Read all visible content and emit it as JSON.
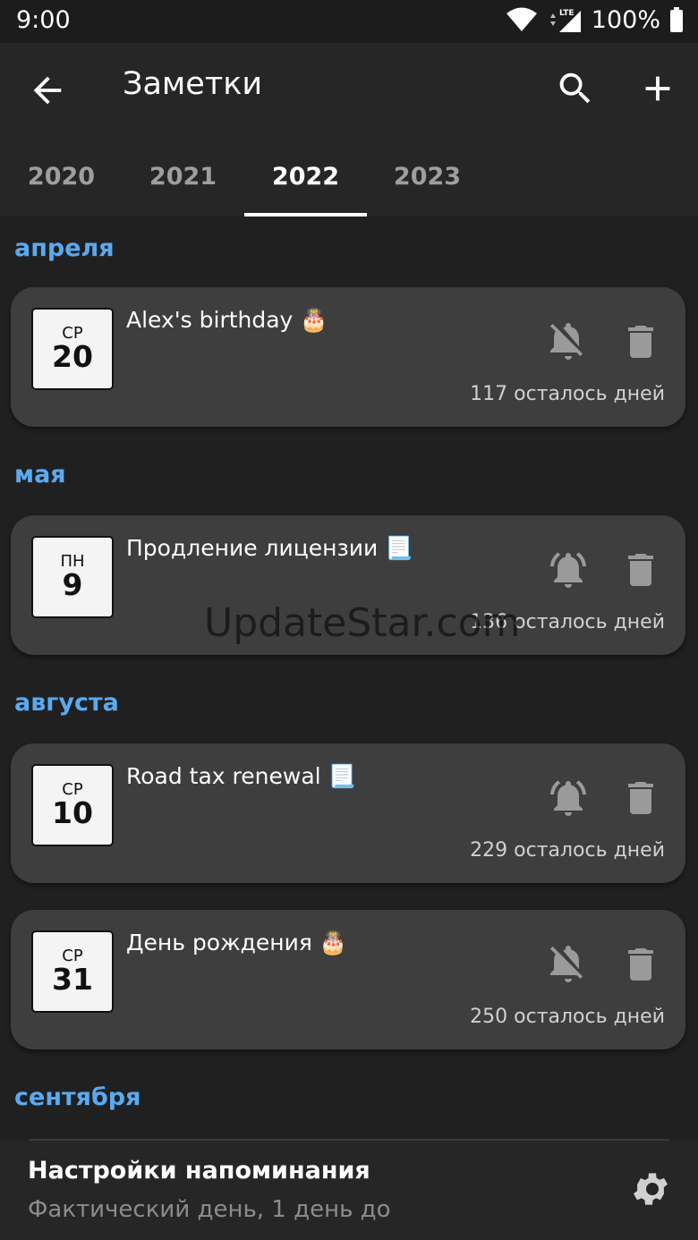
{
  "status": {
    "time": "9:00",
    "network": "LTE",
    "battery": "100%"
  },
  "appbar": {
    "title": "Заметки"
  },
  "tabs": [
    {
      "label": "2020"
    },
    {
      "label": "2021"
    },
    {
      "label": "2022",
      "active": true
    },
    {
      "label": "2023"
    }
  ],
  "months": [
    {
      "label": "апреля"
    },
    {
      "label": "мая"
    },
    {
      "label": "августа"
    },
    {
      "label": "сентября"
    }
  ],
  "notes": [
    {
      "dow": "СР",
      "day": "20",
      "title": "Alex's birthday 🎂",
      "remaining": "117 осталось дней",
      "bell": "bell-off-icon"
    },
    {
      "dow": "ПН",
      "day": "9",
      "title": "Продление лицензии 📃",
      "remaining": "136 осталось дней",
      "bell": "bell-icon"
    },
    {
      "dow": "СР",
      "day": "10",
      "title": "Road tax renewal 📃",
      "remaining": "229 осталось дней",
      "bell": "bell-icon"
    },
    {
      "dow": "СР",
      "day": "31",
      "title": "День рождения 🎂",
      "remaining": "250 осталось дней",
      "bell": "bell-off-icon"
    }
  ],
  "footer": {
    "title": "Настройки напоминания",
    "subtitle": "Фактический день, 1 день до"
  },
  "watermark": "UpdateStar.com",
  "colors": {
    "accent": "#5aaaf0",
    "card": "#3e3e3e",
    "background": "#202020"
  }
}
